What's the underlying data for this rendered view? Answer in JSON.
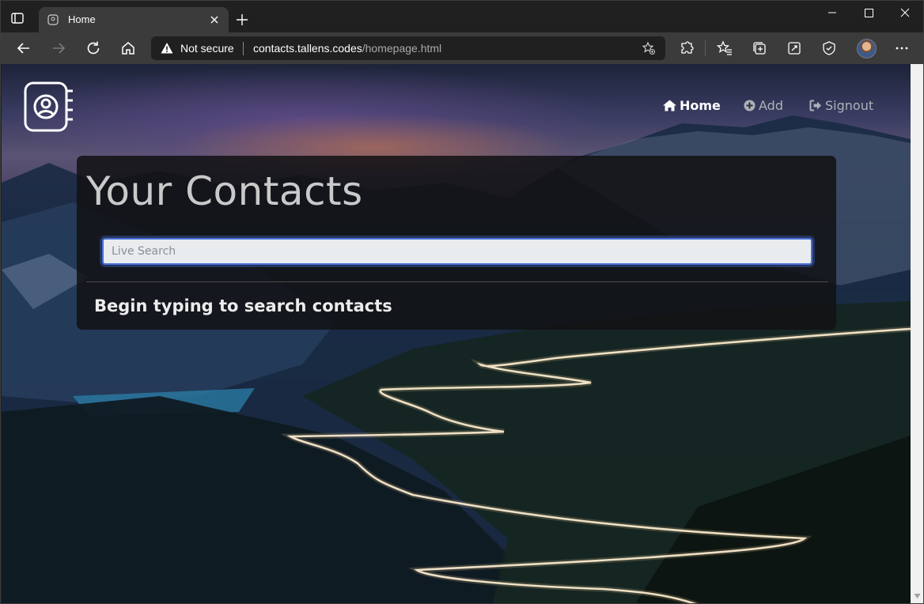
{
  "browser": {
    "tab_title": "Home",
    "security_label": "Not secure",
    "url_host": "contacts.tallens.codes",
    "url_path": "/homepage.html"
  },
  "site": {
    "nav": {
      "home": "Home",
      "add": "Add",
      "signout": "Signout"
    }
  },
  "contacts": {
    "title": "Your Contacts",
    "search_placeholder": "Live Search",
    "hint": "Begin typing to search contacts"
  }
}
